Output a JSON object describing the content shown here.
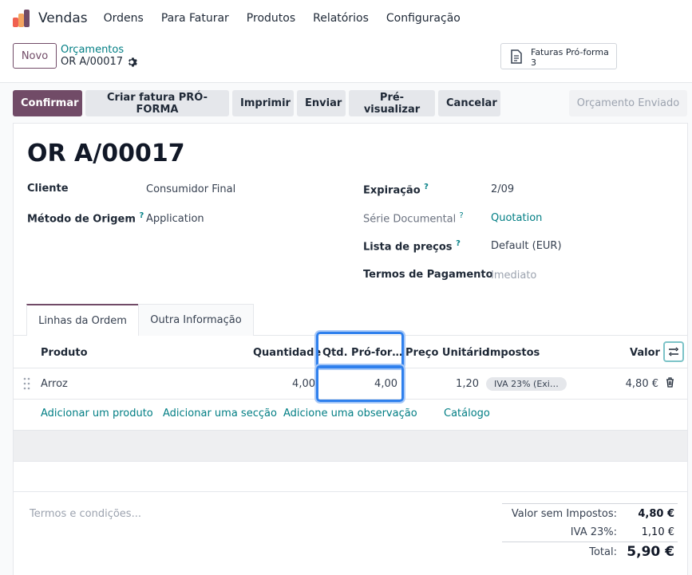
{
  "app": {
    "name": "Vendas",
    "menu": [
      "Ordens",
      "Para Faturar",
      "Produtos",
      "Relatórios",
      "Configuração"
    ],
    "brand_colors": [
      "#f06050",
      "#f4a460",
      "#714b67"
    ]
  },
  "control_panel": {
    "new_label": "Novo",
    "breadcrumb_parent": "Orçamentos",
    "breadcrumb_current": "OR A/00017",
    "smart_button_label": "Faturas Pró-forma",
    "smart_button_count": "3"
  },
  "actions": {
    "confirm": "Confirmar",
    "proforma": "Criar fatura PRÓ-FORMA",
    "print": "Imprimir",
    "send": "Enviar",
    "preview": "Pré-visualizar",
    "cancel": "Cancelar",
    "status": "Orçamento Enviado"
  },
  "form": {
    "title": "OR A/00017",
    "left": {
      "cliente_label": "Cliente",
      "cliente_value": "Consumidor Final",
      "origem_label": "Método de Origem",
      "origem_value": "Application"
    },
    "right": {
      "expiracao_label": "Expiração",
      "expiracao_value": "2/09",
      "serie_label": "Série Documental",
      "serie_value": "Quotation",
      "lista_label": "Lista de preços",
      "lista_value": "Default (EUR)",
      "termos_label": "Termos de Pagamento",
      "termos_value": "Imediato"
    },
    "help_mark": "?"
  },
  "tabs": [
    "Linhas da Ordem",
    "Outra Informação"
  ],
  "table": {
    "headers": {
      "produto": "Produto",
      "quantidade": "Quantidade",
      "qtd_proforma": "Qtd. Pró-for…",
      "preco": "Preço Unitário",
      "impostos": "Impostos",
      "valor": "Valor"
    },
    "rows": [
      {
        "produto": "Arroz",
        "quantidade": "4,00",
        "qtd_proforma": "4,00",
        "preco": "1,20",
        "impostos": "IVA 23% (Exi…",
        "valor": "4,80 €"
      }
    ],
    "links": [
      "Adicionar um produto",
      "Adicionar uma secção",
      "Adicione uma observação",
      "Catálogo"
    ]
  },
  "footer": {
    "terms_placeholder": "Termos e condições...",
    "untaxed_label": "Valor sem Impostos:",
    "untaxed_value": "4,80 €",
    "vat_label": "IVA 23%:",
    "vat_value": "1,10 €",
    "total_label": "Total:",
    "total_value": "5,90 €"
  }
}
